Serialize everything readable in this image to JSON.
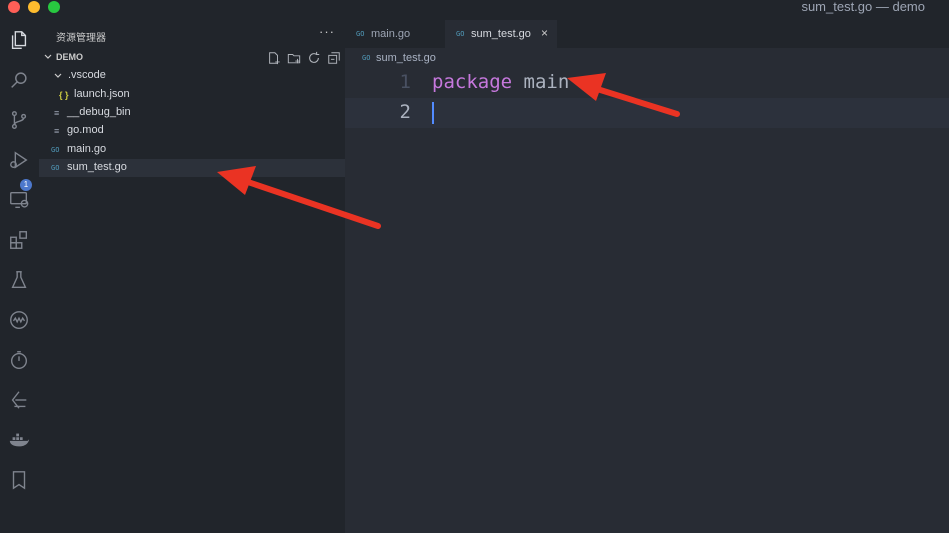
{
  "window": {
    "title": "sum_test.go — demo"
  },
  "activity_bar": {
    "icons": [
      "explorer-icon",
      "search-icon",
      "source-control-icon",
      "run-debug-icon",
      "remote-explorer-icon",
      "extensions-icon",
      "testing-icon",
      "codeium-icon",
      "timer-icon",
      "deploy-icon",
      "docker-icon",
      "bookmark-icon"
    ],
    "badge": "1"
  },
  "sidebar": {
    "title": "资源管理器",
    "more": "···",
    "section": "DEMO",
    "tree": [
      {
        "label": ".vscode",
        "icon": "chevron-down",
        "level": 1
      },
      {
        "label": "launch.json",
        "icon": "{ }",
        "level": 2
      },
      {
        "label": "__debug_bin",
        "icon": "≡",
        "level": 1
      },
      {
        "label": "go.mod",
        "icon": "≡",
        "level": 1
      },
      {
        "label": "main.go",
        "icon": "GO",
        "level": 1
      },
      {
        "label": "sum_test.go",
        "icon": "GO",
        "level": 1,
        "selected": true
      }
    ]
  },
  "tabs": [
    {
      "label": "main.go",
      "active": false
    },
    {
      "label": "sum_test.go",
      "active": true,
      "close": "×"
    }
  ],
  "editor": {
    "breadcrumb": "sum_test.go",
    "go_badge": "GO",
    "lines": [
      {
        "number": "1",
        "keyword": "package",
        "rest": " main"
      },
      {
        "number": "2",
        "keyword": "",
        "rest": ""
      }
    ]
  },
  "colors": {
    "background": "#21252b",
    "editor_bg": "#282c34",
    "keyword": "#c678dd",
    "go_icon": "#519aba",
    "annotation_arrow": "#ea3323"
  }
}
